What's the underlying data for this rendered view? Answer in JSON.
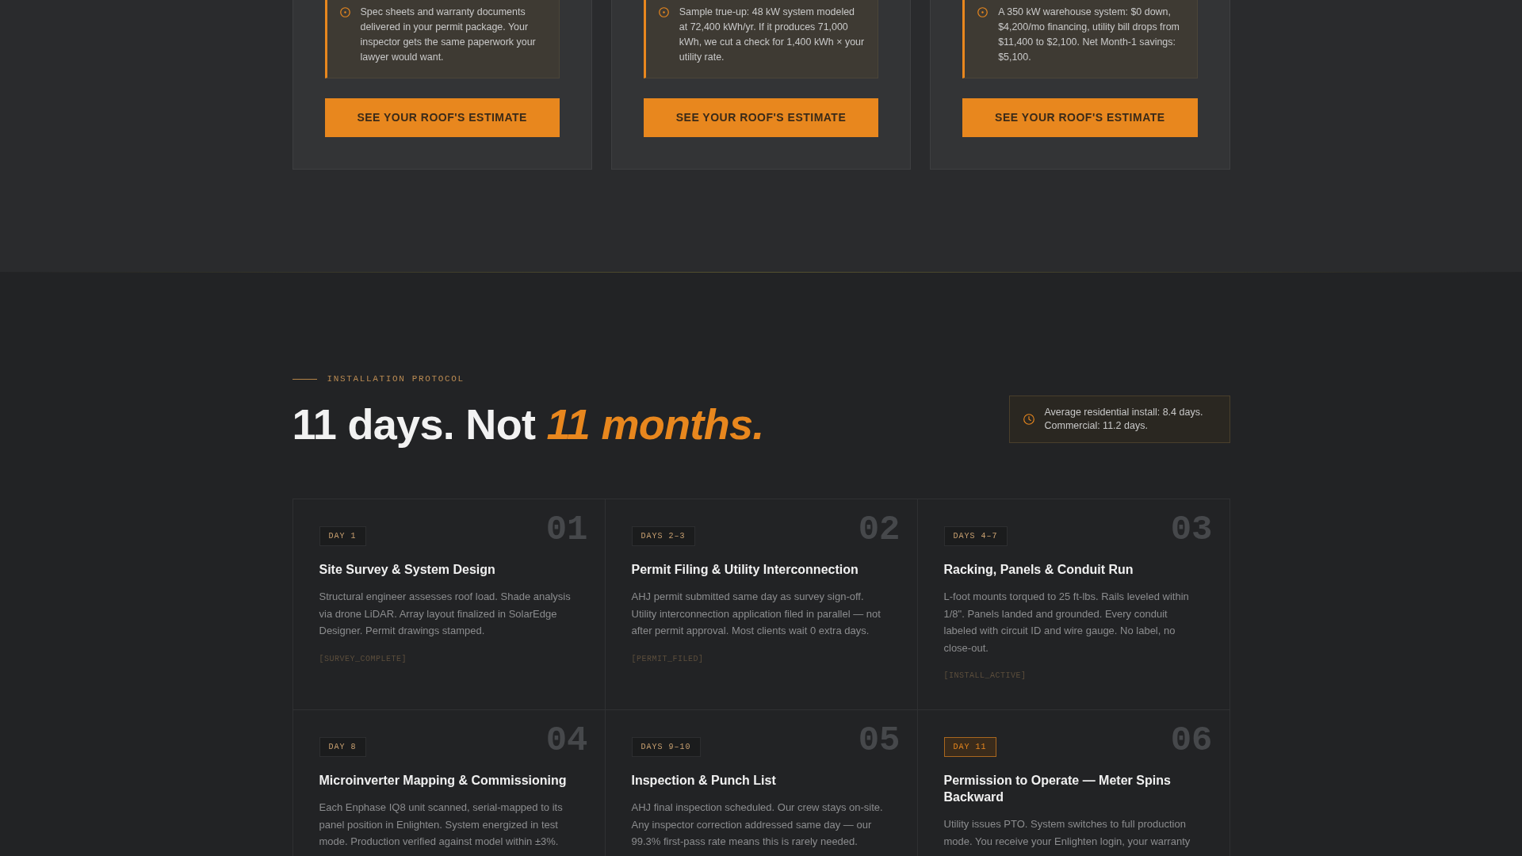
{
  "plans": [
    {
      "note": "Spec sheets and warranty documents delivered in your permit package. Your inspector gets the same paperwork your lawyer would want.",
      "button": "SEE YOUR ROOF'S ESTIMATE"
    },
    {
      "note": "Sample true-up: 48 kW system modeled at 72,400 kWh/yr. If it produces 71,000 kWh, we cut a check for 1,400 kWh × your utility rate.",
      "button": "SEE YOUR ROOF'S ESTIMATE"
    },
    {
      "note": "A 350 kW warehouse system: $0 down, $4,200/mo financing, utility bill drops from $11,400 to $2,100. Net Month-1 savings: $5,100.",
      "button": "SEE YOUR ROOF'S ESTIMATE"
    }
  ],
  "installation": {
    "eyebrow": "INSTALLATION PROTOCOL",
    "heading": "11 days. Not *11 months.*",
    "stat": "Average residential install: 8.4 days. Commercial: 11.2 days.",
    "steps": [
      {
        "badge": "DAY 1",
        "number": "01",
        "title": "Site Survey & System Design",
        "description": "Structural engineer assesses roof load. Shade analysis via drone LiDAR. Array layout finalized in SolarEdge Designer. Permit drawings stamped.",
        "tag": "[SURVEY_COMPLETE]",
        "active": false
      },
      {
        "badge": "DAYS 2–3",
        "number": "02",
        "title": "Permit Filing & Utility Interconnection",
        "description": "AHJ permit submitted same day as survey sign-off. Utility interconnection application filed in parallel — not after permit approval. Most clients wait 0 extra days.",
        "tag": "[PERMIT_FILED]",
        "active": false
      },
      {
        "badge": "DAYS 4–7",
        "number": "03",
        "title": "Racking, Panels & Conduit Run",
        "description": "L-foot mounts torqued to 25 ft-lbs. Rails leveled within 1/8\". Panels landed and grounded. Every conduit labeled with circuit ID and wire gauge. No label, no close-out.",
        "tag": "[INSTALL_ACTIVE]",
        "active": false
      },
      {
        "badge": "DAY 8",
        "number": "04",
        "title": "Microinverter Mapping & Commissioning",
        "description": "Each Enphase IQ8 unit scanned, serial-mapped to its panel position in Enlighten. System energized in test mode. Production verified against model within ±3%.",
        "active": false
      },
      {
        "badge": "DAYS 9–10",
        "number": "05",
        "title": "Inspection & Punch List",
        "description": "AHJ final inspection scheduled. Our crew stays on-site. Any inspector correction addressed same day — our 99.3% first-pass rate means this is rarely needed.",
        "active": false
      },
      {
        "badge": "DAY 11",
        "number": "06",
        "title": "Permission to Operate — Meter Spins Backward",
        "description": "Utility issues PTO. System switches to full production mode. You receive your Enlighten login, your warranty",
        "active": true
      }
    ]
  }
}
